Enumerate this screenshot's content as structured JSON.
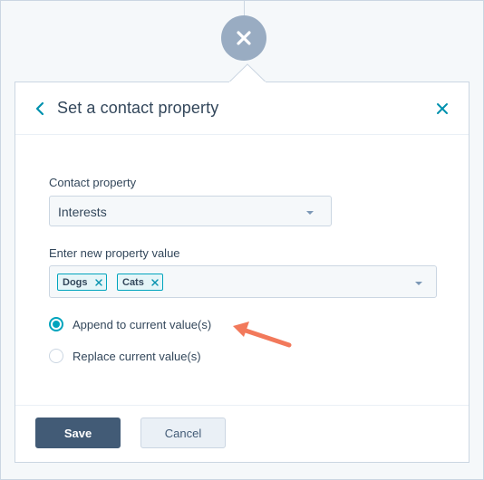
{
  "panel": {
    "title": "Set a contact property",
    "contact_property_label": "Contact property",
    "contact_property_value": "Interests",
    "new_value_label": "Enter new property value",
    "tags": [
      "Dogs",
      "Cats"
    ],
    "options": [
      {
        "label": "Append to current value(s)",
        "checked": true
      },
      {
        "label": "Replace current value(s)",
        "checked": false
      }
    ],
    "save_label": "Save",
    "cancel_label": "Cancel"
  },
  "icons": {
    "top": "close-circle-icon",
    "back": "chevron-left-icon",
    "close": "close-icon",
    "annotation": "arrow-annotation"
  },
  "colors": {
    "accent": "#00a4bd",
    "primary_button": "#425b76",
    "annotation_arrow": "#f2795b"
  }
}
